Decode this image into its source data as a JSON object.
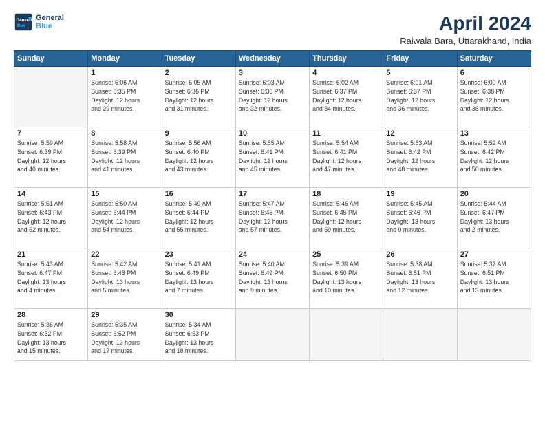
{
  "logo": {
    "line1": "General",
    "line2": "Blue"
  },
  "title": "April 2024",
  "location": "Raiwala Bara, Uttarakhand, India",
  "weekdays": [
    "Sunday",
    "Monday",
    "Tuesday",
    "Wednesday",
    "Thursday",
    "Friday",
    "Saturday"
  ],
  "weeks": [
    [
      {
        "day": "",
        "info": ""
      },
      {
        "day": "1",
        "info": "Sunrise: 6:06 AM\nSunset: 6:35 PM\nDaylight: 12 hours\nand 29 minutes."
      },
      {
        "day": "2",
        "info": "Sunrise: 6:05 AM\nSunset: 6:36 PM\nDaylight: 12 hours\nand 31 minutes."
      },
      {
        "day": "3",
        "info": "Sunrise: 6:03 AM\nSunset: 6:36 PM\nDaylight: 12 hours\nand 32 minutes."
      },
      {
        "day": "4",
        "info": "Sunrise: 6:02 AM\nSunset: 6:37 PM\nDaylight: 12 hours\nand 34 minutes."
      },
      {
        "day": "5",
        "info": "Sunrise: 6:01 AM\nSunset: 6:37 PM\nDaylight: 12 hours\nand 36 minutes."
      },
      {
        "day": "6",
        "info": "Sunrise: 6:00 AM\nSunset: 6:38 PM\nDaylight: 12 hours\nand 38 minutes."
      }
    ],
    [
      {
        "day": "7",
        "info": "Sunrise: 5:59 AM\nSunset: 6:39 PM\nDaylight: 12 hours\nand 40 minutes."
      },
      {
        "day": "8",
        "info": "Sunrise: 5:58 AM\nSunset: 6:39 PM\nDaylight: 12 hours\nand 41 minutes."
      },
      {
        "day": "9",
        "info": "Sunrise: 5:56 AM\nSunset: 6:40 PM\nDaylight: 12 hours\nand 43 minutes."
      },
      {
        "day": "10",
        "info": "Sunrise: 5:55 AM\nSunset: 6:41 PM\nDaylight: 12 hours\nand 45 minutes."
      },
      {
        "day": "11",
        "info": "Sunrise: 5:54 AM\nSunset: 6:41 PM\nDaylight: 12 hours\nand 47 minutes."
      },
      {
        "day": "12",
        "info": "Sunrise: 5:53 AM\nSunset: 6:42 PM\nDaylight: 12 hours\nand 48 minutes."
      },
      {
        "day": "13",
        "info": "Sunrise: 5:52 AM\nSunset: 6:42 PM\nDaylight: 12 hours\nand 50 minutes."
      }
    ],
    [
      {
        "day": "14",
        "info": "Sunrise: 5:51 AM\nSunset: 6:43 PM\nDaylight: 12 hours\nand 52 minutes."
      },
      {
        "day": "15",
        "info": "Sunrise: 5:50 AM\nSunset: 6:44 PM\nDaylight: 12 hours\nand 54 minutes."
      },
      {
        "day": "16",
        "info": "Sunrise: 5:49 AM\nSunset: 6:44 PM\nDaylight: 12 hours\nand 55 minutes."
      },
      {
        "day": "17",
        "info": "Sunrise: 5:47 AM\nSunset: 6:45 PM\nDaylight: 12 hours\nand 57 minutes."
      },
      {
        "day": "18",
        "info": "Sunrise: 5:46 AM\nSunset: 6:45 PM\nDaylight: 12 hours\nand 59 minutes."
      },
      {
        "day": "19",
        "info": "Sunrise: 5:45 AM\nSunset: 6:46 PM\nDaylight: 13 hours\nand 0 minutes."
      },
      {
        "day": "20",
        "info": "Sunrise: 5:44 AM\nSunset: 6:47 PM\nDaylight: 13 hours\nand 2 minutes."
      }
    ],
    [
      {
        "day": "21",
        "info": "Sunrise: 5:43 AM\nSunset: 6:47 PM\nDaylight: 13 hours\nand 4 minutes."
      },
      {
        "day": "22",
        "info": "Sunrise: 5:42 AM\nSunset: 6:48 PM\nDaylight: 13 hours\nand 5 minutes."
      },
      {
        "day": "23",
        "info": "Sunrise: 5:41 AM\nSunset: 6:49 PM\nDaylight: 13 hours\nand 7 minutes."
      },
      {
        "day": "24",
        "info": "Sunrise: 5:40 AM\nSunset: 6:49 PM\nDaylight: 13 hours\nand 9 minutes."
      },
      {
        "day": "25",
        "info": "Sunrise: 5:39 AM\nSunset: 6:50 PM\nDaylight: 13 hours\nand 10 minutes."
      },
      {
        "day": "26",
        "info": "Sunrise: 5:38 AM\nSunset: 6:51 PM\nDaylight: 13 hours\nand 12 minutes."
      },
      {
        "day": "27",
        "info": "Sunrise: 5:37 AM\nSunset: 6:51 PM\nDaylight: 13 hours\nand 13 minutes."
      }
    ],
    [
      {
        "day": "28",
        "info": "Sunrise: 5:36 AM\nSunset: 6:52 PM\nDaylight: 13 hours\nand 15 minutes."
      },
      {
        "day": "29",
        "info": "Sunrise: 5:35 AM\nSunset: 6:52 PM\nDaylight: 13 hours\nand 17 minutes."
      },
      {
        "day": "30",
        "info": "Sunrise: 5:34 AM\nSunset: 6:53 PM\nDaylight: 13 hours\nand 18 minutes."
      },
      {
        "day": "",
        "info": ""
      },
      {
        "day": "",
        "info": ""
      },
      {
        "day": "",
        "info": ""
      },
      {
        "day": "",
        "info": ""
      }
    ]
  ]
}
